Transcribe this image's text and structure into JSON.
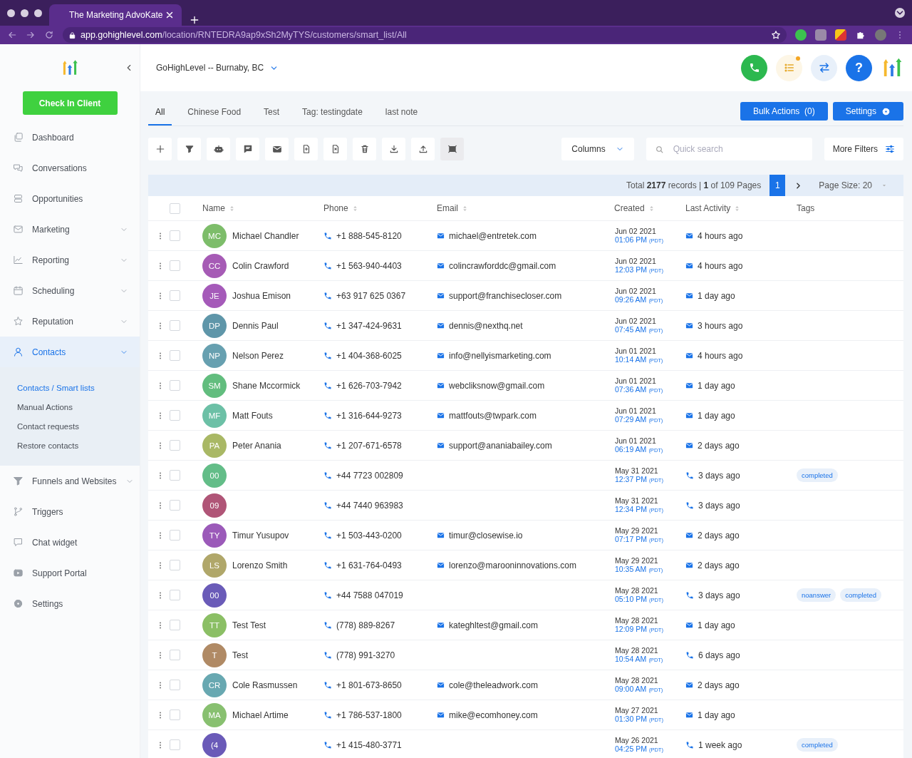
{
  "browser": {
    "tab_title": "The Marketing AdvoKate",
    "url_host": "app.gohighlevel.com",
    "url_path": "/location/RNTEDRA9ap9xSh2MyTYS/customers/smart_list/All"
  },
  "sidebar": {
    "check_in_button": "Check In Client",
    "items": [
      {
        "label": "Dashboard",
        "kind": "dashboard",
        "selected": false,
        "expandable": false
      },
      {
        "label": "Conversations",
        "kind": "conversations",
        "selected": false,
        "expandable": false
      },
      {
        "label": "Opportunities",
        "kind": "opportunities",
        "selected": false,
        "expandable": false
      },
      {
        "label": "Marketing",
        "kind": "marketing",
        "selected": false,
        "expandable": true
      },
      {
        "label": "Reporting",
        "kind": "reporting",
        "selected": false,
        "expandable": true
      },
      {
        "label": "Scheduling",
        "kind": "scheduling",
        "selected": false,
        "expandable": true
      },
      {
        "label": "Reputation",
        "kind": "reputation",
        "selected": false,
        "expandable": true
      },
      {
        "label": "Contacts",
        "kind": "contacts",
        "selected": true,
        "expandable": true,
        "children": [
          {
            "label": "Contacts / Smart lists",
            "selected": true
          },
          {
            "label": "Manual Actions",
            "selected": false
          },
          {
            "label": "Contact requests",
            "selected": false
          },
          {
            "label": "Restore contacts",
            "selected": false
          }
        ]
      },
      {
        "label": "Funnels and Websites",
        "kind": "funnels",
        "selected": false,
        "expandable": true
      },
      {
        "label": "Triggers",
        "kind": "triggers",
        "selected": false,
        "expandable": false
      },
      {
        "label": "Chat widget",
        "kind": "chat_widget",
        "selected": false,
        "expandable": false
      },
      {
        "label": "Support Portal",
        "kind": "support",
        "selected": false,
        "expandable": false
      },
      {
        "label": "Settings",
        "kind": "settings",
        "selected": false,
        "expandable": false
      }
    ]
  },
  "header": {
    "location": "GoHighLevel -- Burnaby, BC",
    "tasks_notification": true,
    "help_label": "?"
  },
  "tabs": [
    {
      "label": "All",
      "selected": true
    },
    {
      "label": "Chinese Food",
      "selected": false
    },
    {
      "label": "Test",
      "selected": false
    },
    {
      "label": "Tag: testingdate",
      "selected": false
    },
    {
      "label": "last note",
      "selected": false
    }
  ],
  "bulk_actions_button": "Bulk Actions  (0)",
  "settings_button": "Settings",
  "toolbar": [
    {
      "kind": "add",
      "selected": false
    },
    {
      "kind": "filter",
      "selected": false
    },
    {
      "kind": "robot",
      "selected": false
    },
    {
      "kind": "message",
      "selected": false
    },
    {
      "kind": "mail",
      "selected": false
    },
    {
      "kind": "tag_add",
      "selected": false
    },
    {
      "kind": "tag_remove",
      "selected": false
    },
    {
      "kind": "delete",
      "selected": false
    },
    {
      "kind": "download",
      "selected": false
    },
    {
      "kind": "upload",
      "selected": false
    },
    {
      "kind": "merge",
      "selected": true
    }
  ],
  "columns_button": "Columns",
  "search": {
    "placeholder": "Quick search"
  },
  "more_filters_button": "More Filters",
  "pagination": {
    "summary": "Total **2177** records | **1** of 109 Pages",
    "pages": [
      {
        "label": "1",
        "selected": true
      }
    ],
    "page_size": "Page Size: 20"
  },
  "table": {
    "select_all_checked": false,
    "columns": [
      "Name",
      "Phone",
      "Email",
      "Created",
      "Last Activity",
      "Tags"
    ],
    "rows": [
      {
        "initials": "MC",
        "color": "#7dbd6a",
        "name": "Michael Chandler",
        "phone": "+1 888-545-8120",
        "email": "michael@entretek.com",
        "created_date": "Jun 02 2021",
        "created_time": "01:06 PM",
        "timezone": "(PDT)",
        "last_activity": {
          "kind": "email",
          "text": "4 hours ago"
        },
        "checked": false,
        "tags": []
      },
      {
        "initials": "CC",
        "color": "#a65bb5",
        "name": "Colin Crawford",
        "phone": "+1 563-940-4403",
        "email": "colincrawforddc@gmail.com",
        "created_date": "Jun 02 2021",
        "created_time": "12:03 PM",
        "timezone": "(PDT)",
        "last_activity": {
          "kind": "email",
          "text": "4 hours ago"
        },
        "checked": false,
        "tags": []
      },
      {
        "initials": "JE",
        "color": "#a55ab9",
        "name": "Joshua Emison",
        "phone": "+63 917 625 0367",
        "email": "support@franchisecloser.com",
        "created_date": "Jun 02 2021",
        "created_time": "09:26 AM",
        "timezone": "(PDT)",
        "last_activity": {
          "kind": "email",
          "text": "1 day ago"
        },
        "checked": false,
        "tags": []
      },
      {
        "initials": "DP",
        "color": "#5f96a9",
        "name": "Dennis Paul",
        "phone": "+1 347-424-9631",
        "email": "dennis@nexthq.net",
        "created_date": "Jun 02 2021",
        "created_time": "07:45 AM",
        "timezone": "(PDT)",
        "last_activity": {
          "kind": "email",
          "text": "3 hours ago"
        },
        "checked": false,
        "tags": []
      },
      {
        "initials": "NP",
        "color": "#67a0b0",
        "name": "Nelson Perez",
        "phone": "+1 404-368-6025",
        "email": "info@nellyismarketing.com",
        "created_date": "Jun 01 2021",
        "created_time": "10:14 AM",
        "timezone": "(PDT)",
        "last_activity": {
          "kind": "email",
          "text": "4 hours ago"
        },
        "checked": false,
        "tags": []
      },
      {
        "initials": "SM",
        "color": "#62bd7e",
        "name": "Shane Mccormick",
        "phone": "+1 626-703-7942",
        "email": "webcliksnow@gmail.com",
        "created_date": "Jun 01 2021",
        "created_time": "07:36 AM",
        "timezone": "(PDT)",
        "last_activity": {
          "kind": "email",
          "text": "1 day ago"
        },
        "checked": false,
        "tags": []
      },
      {
        "initials": "MF",
        "color": "#6cc0a6",
        "name": "Matt Fouts",
        "phone": "+1 316-644-9273",
        "email": "mattfouts@twpark.com",
        "created_date": "Jun 01 2021",
        "created_time": "07:29 AM",
        "timezone": "(PDT)",
        "last_activity": {
          "kind": "email",
          "text": "1 day ago"
        },
        "checked": false,
        "tags": []
      },
      {
        "initials": "PA",
        "color": "#a9b865",
        "name": "Peter Anania",
        "phone": "+1 207-671-6578",
        "email": "support@ananiabailey.com",
        "created_date": "Jun 01 2021",
        "created_time": "06:19 AM",
        "timezone": "(PDT)",
        "last_activity": {
          "kind": "email",
          "text": "2 days ago"
        },
        "checked": false,
        "tags": []
      },
      {
        "initials": "00",
        "color": "#63bd88",
        "name": "",
        "phone": "+44 7723 002809",
        "email": "",
        "created_date": "May 31 2021",
        "created_time": "12:37 PM",
        "timezone": "(PDT)",
        "last_activity": {
          "kind": "call",
          "text": "3 days ago"
        },
        "checked": false,
        "tags": [
          "completed"
        ]
      },
      {
        "initials": "09",
        "color": "#b05577",
        "name": "",
        "phone": "+44 7440 963983",
        "email": "",
        "created_date": "May 31 2021",
        "created_time": "12:34 PM",
        "timezone": "(PDT)",
        "last_activity": {
          "kind": "call",
          "text": "3 days ago"
        },
        "checked": false,
        "tags": []
      },
      {
        "initials": "TY",
        "color": "#9b5ab9",
        "name": "Timur Yusupov",
        "phone": "+1 503-443-0200",
        "email": "timur@closewise.io",
        "created_date": "May 29 2021",
        "created_time": "07:17 PM",
        "timezone": "(PDT)",
        "last_activity": {
          "kind": "email",
          "text": "2 days ago"
        },
        "checked": false,
        "tags": []
      },
      {
        "initials": "LS",
        "color": "#b0a76a",
        "name": "Lorenzo Smith",
        "phone": "+1 631-764-0493",
        "email": "lorenzo@marooninnovations.com",
        "created_date": "May 29 2021",
        "created_time": "10:35 AM",
        "timezone": "(PDT)",
        "last_activity": {
          "kind": "email",
          "text": "2 days ago"
        },
        "checked": false,
        "tags": []
      },
      {
        "initials": "00",
        "color": "#6a5bb8",
        "name": "",
        "phone": "+44 7588 047019",
        "email": "",
        "created_date": "May 28 2021",
        "created_time": "05:10 PM",
        "timezone": "(PDT)",
        "last_activity": {
          "kind": "call",
          "text": "3 days ago"
        },
        "checked": false,
        "tags": [
          "noanswer",
          "completed"
        ]
      },
      {
        "initials": "TT",
        "color": "#8bbf65",
        "name": "Test Test",
        "phone": "(778) 889-8267",
        "email": "kateghltest@gmail.com",
        "created_date": "May 28 2021",
        "created_time": "12:09 PM",
        "timezone": "(PDT)",
        "last_activity": {
          "kind": "email",
          "text": "1 day ago"
        },
        "checked": false,
        "tags": []
      },
      {
        "initials": "T",
        "color": "#b08a65",
        "name": "Test",
        "phone": "(778) 991-3270",
        "email": "",
        "created_date": "May 28 2021",
        "created_time": "10:54 AM",
        "timezone": "(PDT)",
        "last_activity": {
          "kind": "call",
          "text": "6 days ago"
        },
        "checked": false,
        "tags": []
      },
      {
        "initials": "CR",
        "color": "#68a8b1",
        "name": "Cole Rasmussen",
        "phone": "+1 801-673-8650",
        "email": "cole@theleadwork.com",
        "created_date": "May 28 2021",
        "created_time": "09:00 AM",
        "timezone": "(PDT)",
        "last_activity": {
          "kind": "email",
          "text": "2 days ago"
        },
        "checked": false,
        "tags": []
      },
      {
        "initials": "MA",
        "color": "#88c070",
        "name": "Michael Artime",
        "phone": "+1 786-537-1800",
        "email": "mike@ecomhoney.com",
        "created_date": "May 27 2021",
        "created_time": "01:30 PM",
        "timezone": "(PDT)",
        "last_activity": {
          "kind": "email",
          "text": "1 day ago"
        },
        "checked": false,
        "tags": []
      },
      {
        "initials": "(4",
        "color": "#6a5ab8",
        "name": "",
        "phone": "+1 415-480-3771",
        "email": "",
        "created_date": "May 26 2021",
        "created_time": "04:25 PM",
        "timezone": "(PDT)",
        "last_activity": {
          "kind": "call",
          "text": "1 week ago"
        },
        "checked": false,
        "tags": [
          "completed"
        ]
      }
    ]
  }
}
